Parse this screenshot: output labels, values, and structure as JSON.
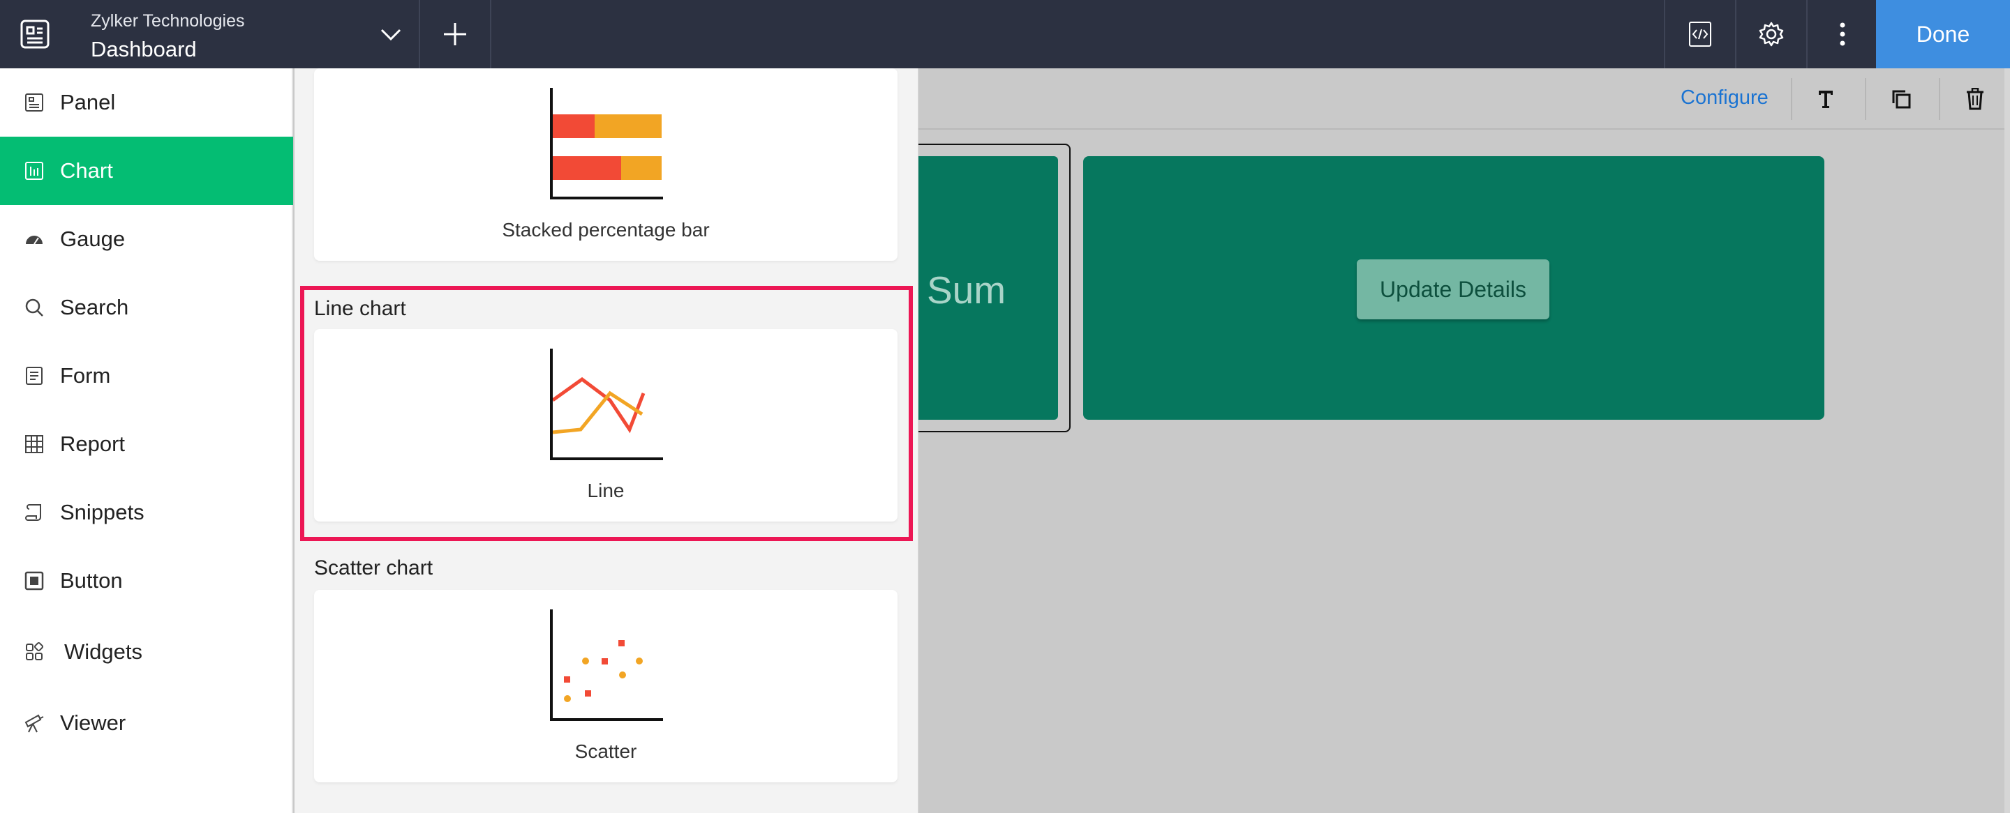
{
  "topbar": {
    "org_name": "Zylker Technologies",
    "page_title": "Dashboard",
    "done_label": "Done"
  },
  "canvas_toolbar": {
    "configure_label": "Configure"
  },
  "tiles": {
    "tile_a_text": "Sum",
    "update_button_label": "Update Details"
  },
  "sidebar": {
    "items": [
      {
        "label": "Panel",
        "icon": "panel-icon"
      },
      {
        "label": "Chart",
        "icon": "chart-icon",
        "active": true
      },
      {
        "label": "Gauge",
        "icon": "gauge-icon"
      },
      {
        "label": "Search",
        "icon": "search-icon"
      },
      {
        "label": "Form",
        "icon": "form-icon"
      },
      {
        "label": "Report",
        "icon": "report-icon"
      },
      {
        "label": "Snippets",
        "icon": "snippets-icon"
      },
      {
        "label": "Button",
        "icon": "button-icon"
      },
      {
        "label": "Widgets",
        "icon": "widgets-icon"
      },
      {
        "label": "Viewer",
        "icon": "viewer-icon"
      }
    ]
  },
  "picker": {
    "cards": [
      {
        "section": "",
        "label": "Stacked percentage bar"
      },
      {
        "section": "Line chart",
        "label": "Line",
        "highlighted": true
      },
      {
        "section": "Scatter chart",
        "label": "Scatter"
      }
    ]
  },
  "colors": {
    "topbar": "#2c3141",
    "done": "#3e8ee0",
    "active_nav": "#04bd73",
    "tile": "#06775e",
    "highlight": "#ec1654",
    "chart_red": "#f24a36",
    "chart_orange": "#f2a524"
  }
}
